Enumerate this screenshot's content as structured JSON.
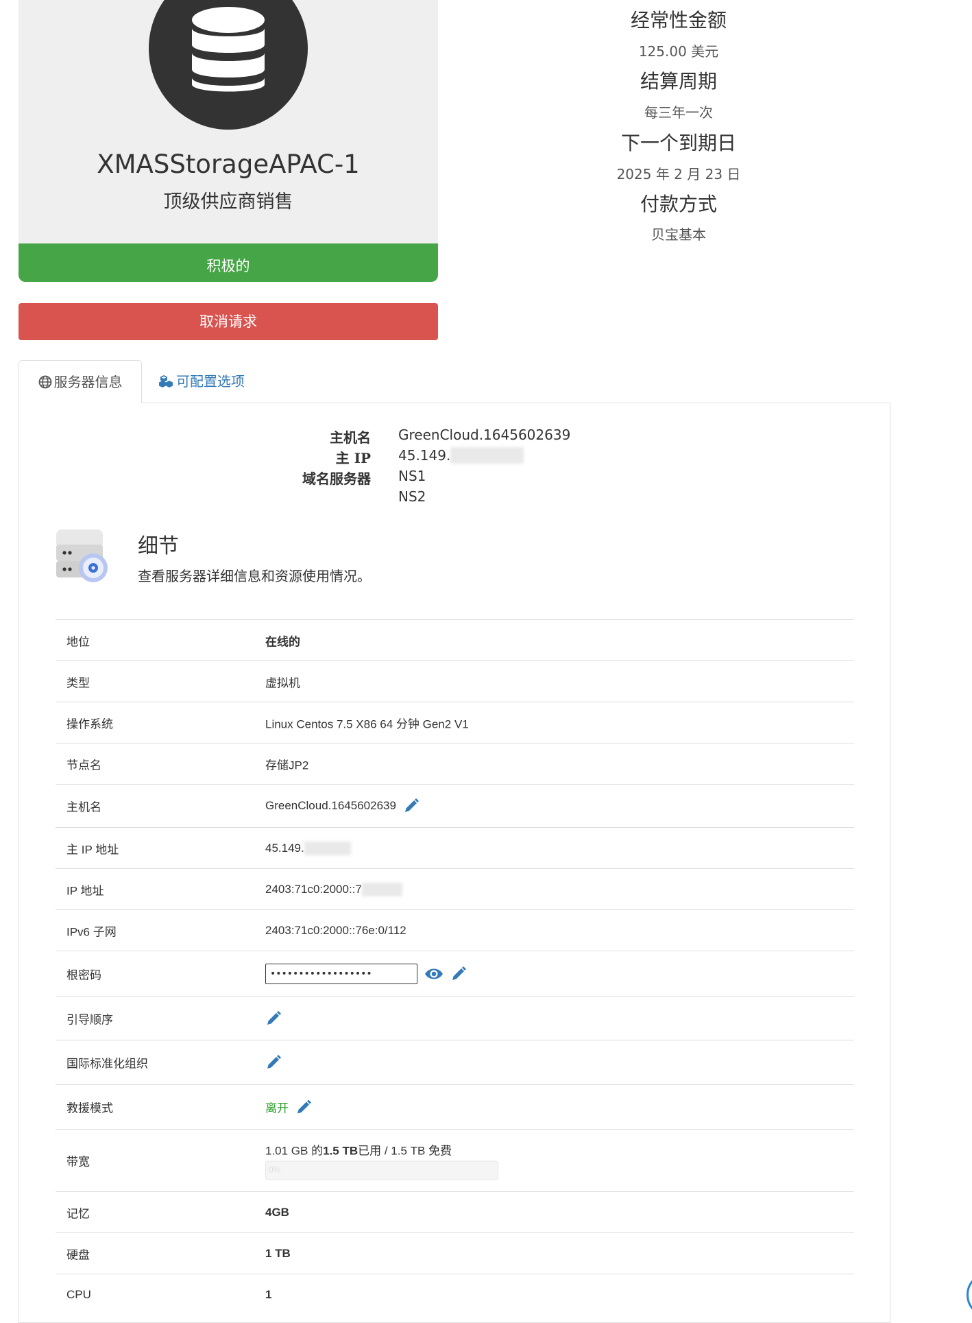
{
  "product": {
    "name": "XMASStorageAPAC-1",
    "group": "顶级供应商销售",
    "status": "积极的",
    "cancel_label": "取消请求"
  },
  "billing": {
    "recurring_label": "经常性金额",
    "recurring_value": "125.00 美元",
    "cycle_label": "结算周期",
    "cycle_value": "每三年一次",
    "due_label": "下一个到期日",
    "due_value": "2025 年 2 月 23 日",
    "payment_label": "付款方式",
    "payment_value": "贝宝基本"
  },
  "tabs": [
    {
      "label": "服务器信息",
      "icon": "globe-icon"
    },
    {
      "label": "可配置选项",
      "icon": "cubes-icon"
    }
  ],
  "server_info": {
    "hostname_label": "主机名",
    "hostname_value": "GreenCloud.1645602639",
    "ip_label": "主 IP",
    "ip_value": "45.149.",
    "ns_label": "域名服务器",
    "ns1": "NS1",
    "ns2": "NS2"
  },
  "details": {
    "title": "细节",
    "description": "查看服务器详细信息和资源使用情况。",
    "rows": {
      "status": {
        "label": "地位",
        "value": "在线的"
      },
      "type": {
        "label": "类型",
        "value": "虚拟机"
      },
      "os": {
        "label": "操作系统",
        "value": "Linux Centos 7.5 X86 64 分钟 Gen2 V1"
      },
      "node": {
        "label": "节点名",
        "value": "存储JP2"
      },
      "hostname": {
        "label": "主机名",
        "value": "GreenCloud.1645602639"
      },
      "main_ip": {
        "label": "主 IP 地址",
        "value": "45.149."
      },
      "ip": {
        "label": "IP 地址",
        "value": "2403:71c0:2000::7"
      },
      "ipv6": {
        "label": "IPv6 子网",
        "value": "2403:71c0:2000::76e:0/112"
      },
      "root_password": {
        "label": "根密码",
        "value": "••••••••••••••••••"
      },
      "boot_order": {
        "label": "引导顺序"
      },
      "iso": {
        "label": "国际标准化组织"
      },
      "rescue": {
        "label": "救援模式",
        "value": "离开"
      },
      "bandwidth": {
        "label": "带宽",
        "used": "1.01 GB",
        "of": " 的",
        "total": "1.5 TB",
        "suffix": "已用 / 1.5 TB 免费",
        "percent_label": "0%",
        "percent": 0
      },
      "memory": {
        "label": "记忆",
        "value": "4GB"
      },
      "disk": {
        "label": "硬盘",
        "value": "1 TB"
      },
      "cpu": {
        "label": "CPU",
        "value": "1"
      }
    }
  },
  "colors": {
    "active_green": "#46a546",
    "cancel_red": "#d9534f",
    "link_blue": "#337ab7",
    "online_green": "#0b8a0b"
  }
}
